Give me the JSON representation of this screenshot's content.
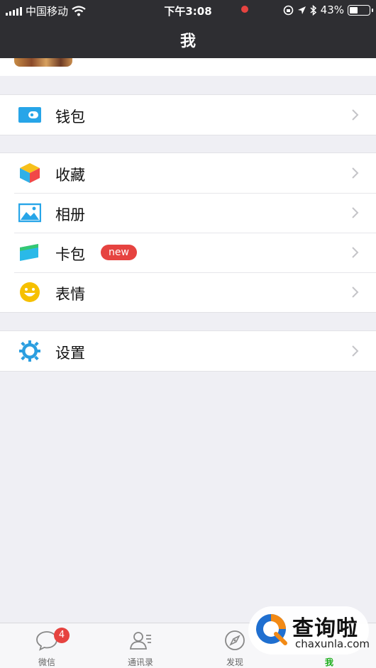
{
  "status": {
    "carrier": "中国移动",
    "time": "下午3:08",
    "battery": "43%",
    "battery_level": 0.43
  },
  "nav": {
    "title": "我"
  },
  "menu": {
    "wallet": {
      "label": "钱包"
    },
    "favorites": {
      "label": "收藏"
    },
    "album": {
      "label": "相册"
    },
    "cards": {
      "label": "卡包",
      "badge": "new"
    },
    "stickers": {
      "label": "表情"
    },
    "settings": {
      "label": "设置"
    }
  },
  "tabs": [
    {
      "label": "微信",
      "badge": "4"
    },
    {
      "label": "通讯录"
    },
    {
      "label": "发现"
    },
    {
      "label": "我"
    }
  ],
  "colors": {
    "active_tab": "#1aad19",
    "badge": "#e64340",
    "nav_bg": "#2e2e32"
  },
  "watermark": {
    "title": "查询啦",
    "subtitle": "chaxunla.com"
  }
}
